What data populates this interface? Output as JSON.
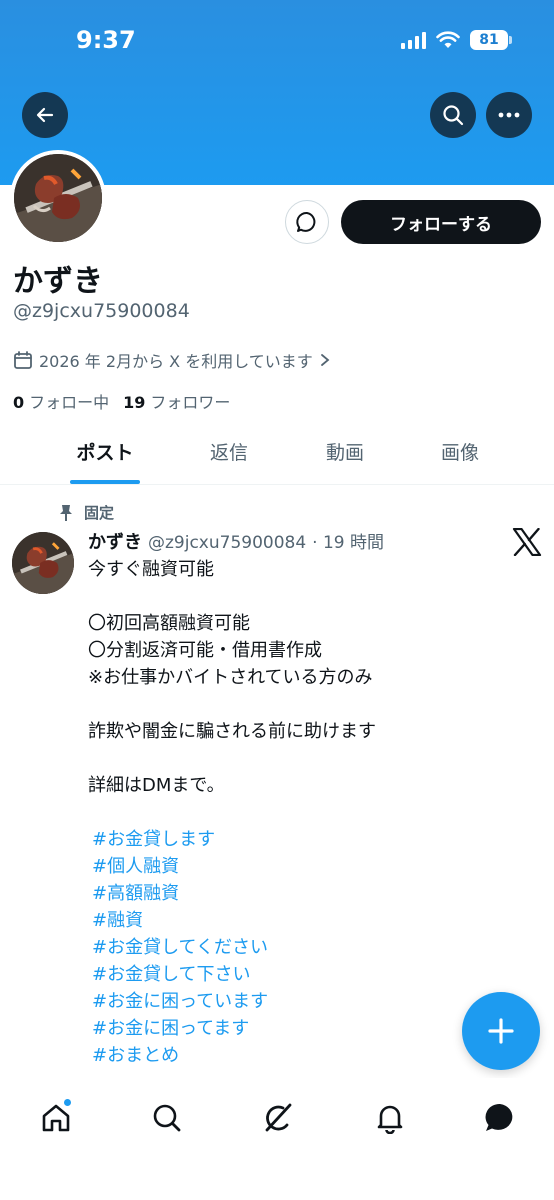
{
  "status_bar": {
    "time": "9:37",
    "battery": "81"
  },
  "profile": {
    "display_name": "かずき",
    "handle": "@z9jcxu75900084",
    "joined": "2026 年 2月から X を利用しています",
    "following_count": "0",
    "following_label": "フォロー中",
    "followers_count": "19",
    "followers_label": "フォロワー",
    "follow_button": "フォローする"
  },
  "tabs": [
    {
      "label": "ポスト"
    },
    {
      "label": "返信"
    },
    {
      "label": "動画"
    },
    {
      "label": "画像"
    }
  ],
  "pinned_post": {
    "pinned_label": "固定",
    "author": "かずき",
    "handle": "@z9jcxu75900084",
    "time": "· 19 時間",
    "lines": [
      "今すぐ融資可能",
      "",
      "〇初回高額融資可能",
      "〇分割返済可能・借用書作成",
      "※お仕事かバイトされている方のみ",
      "",
      "詐欺や闇金に騙される前に助けます",
      "",
      "詳細はDMまで。",
      ""
    ],
    "hashtags": [
      "#お金貸します",
      "#個人融資",
      "#高額融資",
      "#融資",
      "#お金貸してください",
      "#お金貸して下さい",
      "#お金に困っています",
      "#お金に困ってます",
      "#おまとめ"
    ]
  },
  "icons": {
    "back": "back-arrow-icon",
    "search": "search-icon",
    "more": "more-icon",
    "message": "message-icon",
    "calendar": "calendar-icon",
    "pin": "pin-icon",
    "compose": "plus-icon",
    "nav": [
      "home-icon",
      "search-icon",
      "grok-icon",
      "notifications-icon",
      "messages-icon"
    ]
  },
  "colors": {
    "accent": "#1d9bf0",
    "text": "#0f1419",
    "secondary": "#536471"
  }
}
